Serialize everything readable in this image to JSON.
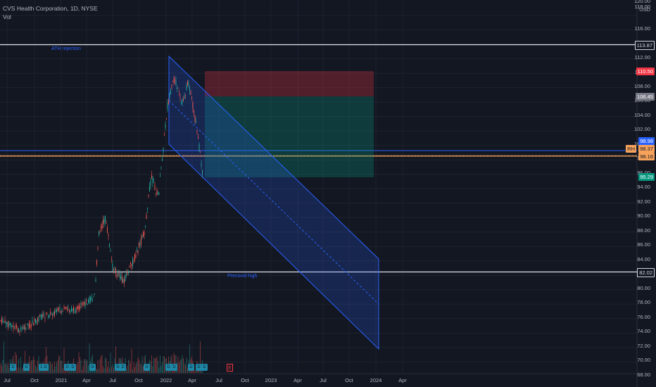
{
  "legend": {
    "symbol_line": "CVS Health Corporation, 1D, NYSE",
    "vol": "Vol"
  },
  "currency": "USD",
  "y_axis_ticks": [
    "120.00",
    "118.00",
    "116.00",
    "112.00",
    "110.00",
    "108.00",
    "106.00",
    "104.00",
    "102.00",
    "100.00",
    "98.00",
    "96.00",
    "94.00",
    "92.00",
    "90.00",
    "88.00",
    "86.00",
    "84.00",
    "82.00",
    "80.00",
    "78.00",
    "76.00",
    "74.00",
    "72.00",
    "70.00",
    "68.00"
  ],
  "x_axis_ticks": [
    "Jul",
    "Oct",
    "2021",
    "Apr",
    "Jul",
    "Oct",
    "2022",
    "Apr",
    "Jul",
    "Oct",
    "2023",
    "Apr",
    "Jul",
    "Oct",
    "2024",
    "Apr"
  ],
  "annotations": {
    "ath": "ATH rejection",
    "precovid": "Precovid high"
  },
  "price_tags": {
    "level_top": "113.87",
    "stop": "110.50",
    "entry": "106.45",
    "blue": "98.98",
    "current_label": "RH",
    "current": "98.37",
    "orange": "98.16",
    "target": "95.29",
    "level_bottom": "82.02"
  },
  "markers": {
    "earnings": "E",
    "dividend": "D"
  },
  "colors": {
    "background": "#131722",
    "up": "#26a69a",
    "down": "#ef5350",
    "channel": "#2962ff",
    "stop_zone": "#f23645",
    "target_zone": "#089981"
  }
}
